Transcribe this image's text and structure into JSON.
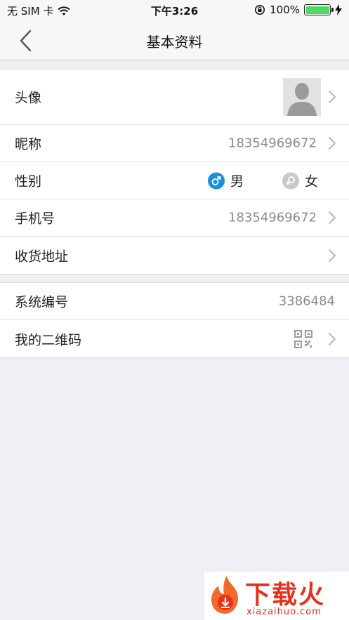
{
  "status_bar": {
    "carrier": "无 SIM 卡",
    "time": "下午3:26",
    "battery": "100%",
    "battery_level": 1.0
  },
  "nav": {
    "title": "基本资料",
    "back_icon": "chevron-left-icon"
  },
  "profile": {
    "avatar_label": "头像",
    "nickname_label": "昵称",
    "nickname_value": "18354969672",
    "gender_label": "性别",
    "gender_male": "男",
    "gender_female": "女",
    "gender_selected": "男",
    "phone_label": "手机号",
    "phone_value": "18354969672",
    "address_label": "收货地址"
  },
  "account": {
    "system_id_label": "系统编号",
    "system_id_value": "3386484",
    "qr_label": "我的二维码",
    "qr_icon": "qr-code-icon"
  },
  "watermark": {
    "brand": "下载火",
    "domain": "xiazaihuo.com"
  },
  "colors": {
    "accent": "#1a8ee1",
    "battery": "#4cd964",
    "watermark": "#e8301c"
  }
}
